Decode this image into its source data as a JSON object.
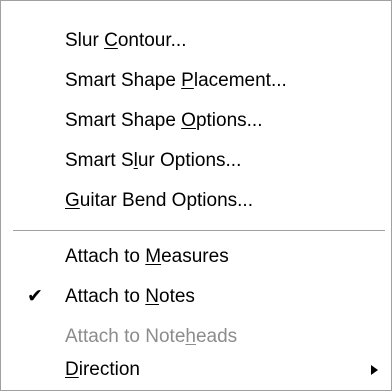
{
  "menu": {
    "items": [
      {
        "pre": "Slur ",
        "key": "C",
        "post": "ontour...",
        "enabled": true,
        "checked": false
      },
      {
        "pre": "Smart Shape ",
        "key": "P",
        "post": "lacement...",
        "enabled": true,
        "checked": false
      },
      {
        "pre": "Smart Shape ",
        "key": "O",
        "post": "ptions...",
        "enabled": true,
        "checked": false
      },
      {
        "pre": "Smart S",
        "key": "l",
        "post": "ur Options...",
        "enabled": true,
        "checked": false
      },
      {
        "pre": "",
        "key": "G",
        "post": "uitar Bend Options...",
        "enabled": true,
        "checked": false
      },
      {
        "pre": "Attach to ",
        "key": "M",
        "post": "easures",
        "enabled": true,
        "checked": false
      },
      {
        "pre": "Attach to ",
        "key": "N",
        "post": "otes",
        "enabled": true,
        "checked": true
      },
      {
        "pre": "Attach to Note",
        "key": "h",
        "post": "eads",
        "enabled": false,
        "checked": false
      },
      {
        "pre": "",
        "key": "D",
        "post": "irection",
        "enabled": true,
        "checked": false,
        "submenu": true
      }
    ],
    "check_glyph": "✔",
    "submenu_icon": "triangle-right-icon",
    "disabled_color": "#8c8c8c"
  }
}
